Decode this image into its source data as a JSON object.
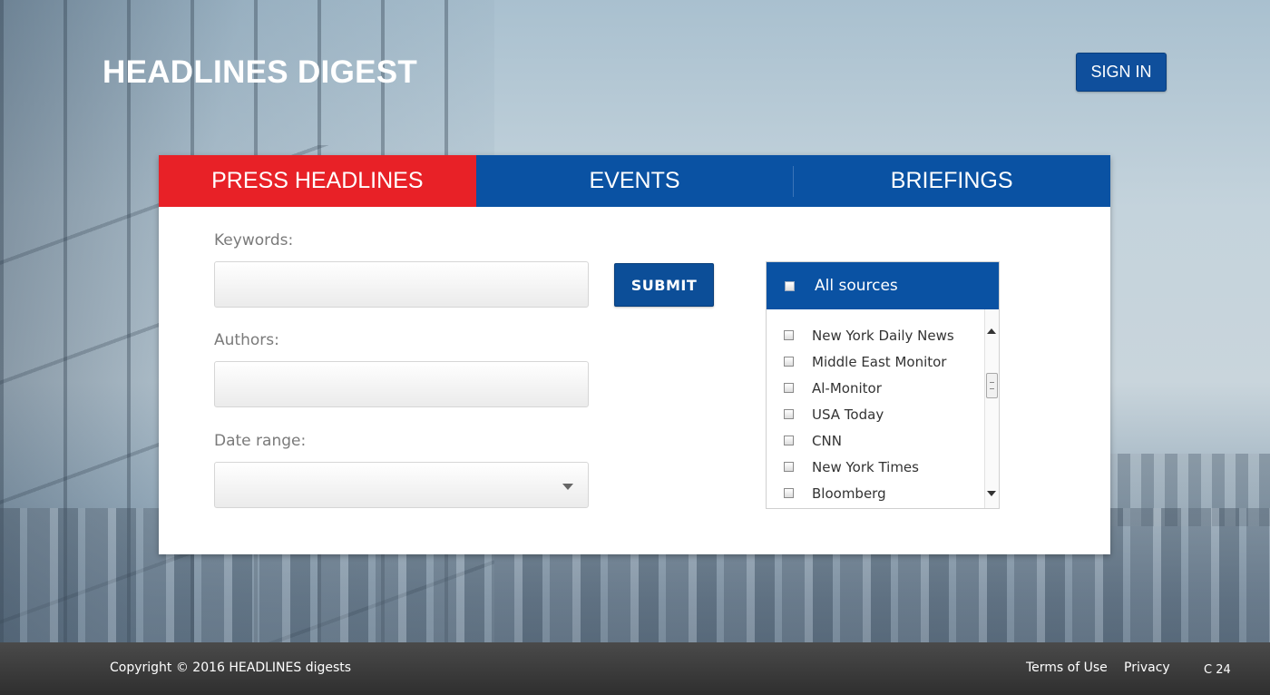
{
  "header": {
    "brand": "HEADLINES DIGEST",
    "signin_label": "SIGN IN"
  },
  "tabs": [
    {
      "label": "PRESS HEADLINES",
      "active": true
    },
    {
      "label": "EVENTS",
      "active": false
    },
    {
      "label": "BRIEFINGS",
      "active": false
    }
  ],
  "form": {
    "keywords_label": "Keywords:",
    "keywords_value": "",
    "authors_label": "Authors:",
    "authors_value": "",
    "date_label": "Date range:",
    "date_value": "",
    "submit_label": "SUBMIT"
  },
  "sources": {
    "all_label": "All sources",
    "items": [
      "New York Daily News",
      "Middle East Monitor",
      "Al-Monitor",
      "USA Today",
      "CNN",
      "New York Times",
      "Bloomberg"
    ]
  },
  "footer": {
    "copyright": "Copyright © 2016 HEADLINES digests",
    "terms": "Terms of Use",
    "privacy": "Privacy",
    "version": "C 24"
  },
  "colors": {
    "primary_blue": "#0a52a3",
    "active_red": "#e82127",
    "footer_bg": "#3a3a3a"
  }
}
